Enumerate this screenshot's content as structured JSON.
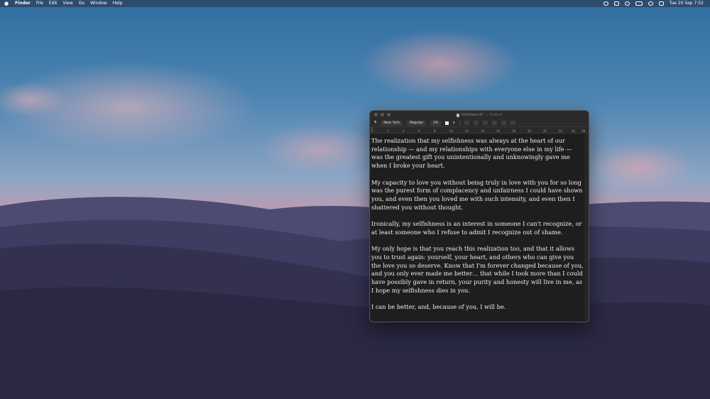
{
  "menubar": {
    "apple": "",
    "items": [
      "Finder",
      "File",
      "Edit",
      "View",
      "Go",
      "Window",
      "Help"
    ],
    "datetime": "Tue 20 Sep  7:52"
  },
  "window": {
    "title": "Untitled.rtf",
    "status": "— Edited",
    "toolbar": {
      "paragraph_icon": "¶",
      "font": "New York",
      "style": "Regular",
      "size": "24",
      "bold_label": "a"
    },
    "ruler_numbers": [
      "0",
      "2",
      "4",
      "6",
      "8",
      "10",
      "12",
      "14",
      "16",
      "18",
      "20",
      "22",
      "24",
      "26",
      "28"
    ],
    "paragraphs": [
      "The realization that my selfishness was always at the heart of our relationship — and my relationships with everyone else in my life — was the greatest gift you unintentionally and unknowingly gave me when I broke your heart.",
      "My capacity to love you without being truly in love with you for so long was the purest form of complacency and unfairness I could have shown you, and even then you loved me with such intensity, and even then I shattered you without thought.",
      "Ironically, my selfishness is an interest in someone I can't recognize, or at least someone who I refuse to admit I recognize out of shame.",
      "My only hope is that you reach this realization too, and that it allows you to trust again: yourself, your heart, and others who can give you the love you so deserve. Know that I'm forever changed because of you, and you only ever made me better… that while I took more than I could have possibly gave in return, your purity and honesty will live in me, as I hope my selfishness dies in you.",
      "I can be better, and, because of you, I will be."
    ]
  }
}
